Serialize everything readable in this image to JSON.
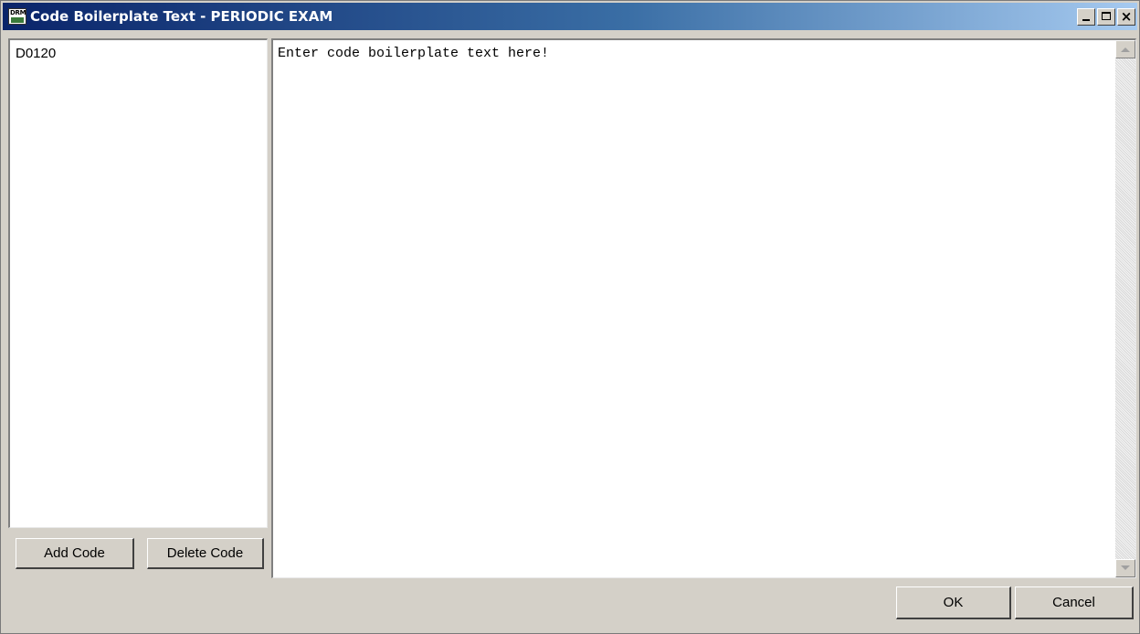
{
  "window": {
    "title": "Code Boilerplate Text - PERIODIC EXAM",
    "app_icon_text": "DRM",
    "controls": {
      "minimize": "minimize",
      "maximize": "maximize",
      "close": "×"
    }
  },
  "code_list": {
    "items": [
      {
        "label": "D0120"
      }
    ]
  },
  "buttons": {
    "add_code": "Add Code",
    "delete_code": "Delete Code",
    "ok": "OK",
    "cancel": "Cancel"
  },
  "editor": {
    "text": "Enter code boilerplate text here!"
  },
  "icons": {
    "app": "drm-app-icon",
    "minimize": "minimize-icon",
    "maximize": "maximize-icon",
    "close": "close-icon",
    "scroll_up": "scroll-up-arrow-icon",
    "scroll_down": "scroll-down-arrow-icon"
  },
  "colors": {
    "titlebar_start": "#0a246a",
    "titlebar_end": "#a6caf0",
    "window_bg": "#d4d0c8"
  }
}
